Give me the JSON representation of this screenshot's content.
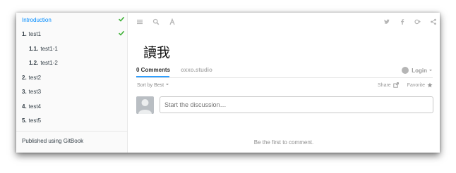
{
  "sidebar": {
    "items": [
      {
        "number": "",
        "label": "Introduction",
        "active": true,
        "checked": true
      },
      {
        "number": "1.",
        "label": "test1",
        "active": false,
        "checked": true
      },
      {
        "number": "1.1.",
        "label": "test1-1",
        "active": false,
        "checked": false
      },
      {
        "number": "1.2.",
        "label": "test1-2",
        "active": false,
        "checked": false
      },
      {
        "number": "2.",
        "label": "test2",
        "active": false,
        "checked": false
      },
      {
        "number": "3.",
        "label": "test3",
        "active": false,
        "checked": false
      },
      {
        "number": "4.",
        "label": "test4",
        "active": false,
        "checked": false
      },
      {
        "number": "5.",
        "label": "test5",
        "active": false,
        "checked": false
      }
    ],
    "published": "Published using GitBook"
  },
  "toolbar": {
    "left_icons": [
      "menu-icon",
      "search-icon",
      "font-icon"
    ],
    "right_icons": [
      "twitter-icon",
      "facebook-icon",
      "google-plus-icon",
      "share-icon"
    ]
  },
  "page": {
    "title": "讀我"
  },
  "discussion": {
    "tab_comments": "0 Comments",
    "tab_site": "oxxo.studio",
    "login": "Login",
    "sort": "Sort by Best",
    "share": "Share",
    "favorite": "Favorite",
    "placeholder": "Start the discussion…",
    "empty": "Be the first to comment."
  },
  "colors": {
    "accent": "#008cff",
    "check": "#3cb034",
    "tab_underline": "#2e9fff"
  }
}
